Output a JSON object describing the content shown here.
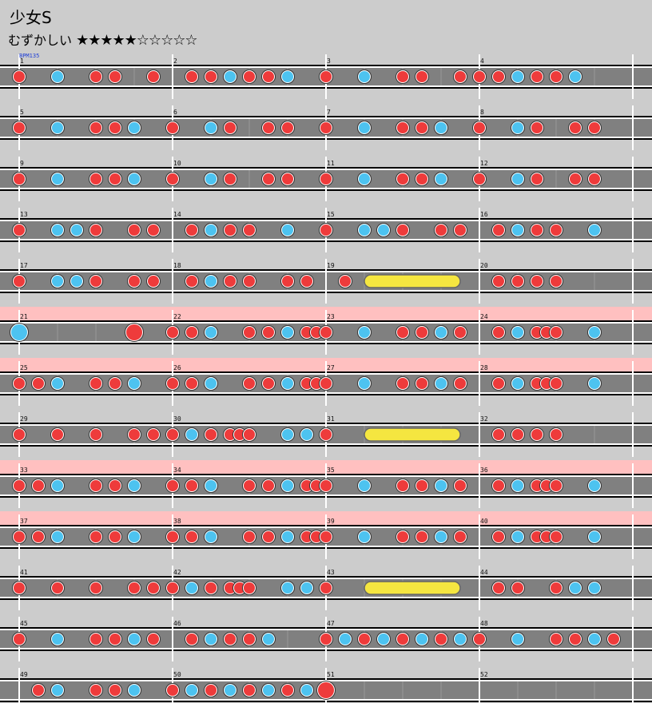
{
  "song": {
    "title": "少女S",
    "difficulty_label": "むずかしい",
    "stars_filled": "★★★★★",
    "stars_empty": "☆☆☆☆☆",
    "star_rating": 5,
    "star_max": 10
  },
  "bpm_label": "BPM135",
  "colors": {
    "background": "#cccccc",
    "lane": "#808080",
    "gogo_band": "#ffc0c0",
    "don": "#ee3b3b",
    "ka": "#4dc3f0",
    "drumroll": "#f5e640"
  },
  "chart_data": {
    "type": "taiko-chart",
    "bpm": 135,
    "measures_per_row": 4,
    "subdivisions_per_measure": 16,
    "notes_legend": "d=don(red) k=ka(blue) D=big don K=big ka",
    "rows": [
      {
        "gogo": false,
        "measures": [
          1,
          2,
          3,
          4
        ],
        "notes": [
          [
            "d",
            0
          ],
          [
            "k",
            4
          ],
          [
            "d",
            8
          ],
          [
            "d",
            10
          ],
          [
            "d",
            14
          ],
          [
            "d",
            18
          ],
          [
            "d",
            20
          ],
          [
            "k",
            22
          ],
          [
            "d",
            24
          ],
          [
            "d",
            26
          ],
          [
            "k",
            28
          ],
          [
            "d",
            32
          ],
          [
            "k",
            36
          ],
          [
            "d",
            40
          ],
          [
            "d",
            42
          ],
          [
            "d",
            46
          ],
          [
            "d",
            48
          ],
          [
            "d",
            50
          ],
          [
            "k",
            52
          ],
          [
            "d",
            54
          ],
          [
            "d",
            56
          ],
          [
            "k",
            58
          ]
        ],
        "rolls": []
      },
      {
        "gogo": false,
        "measures": [
          5,
          6,
          7,
          8
        ],
        "notes": [
          [
            "d",
            0
          ],
          [
            "k",
            4
          ],
          [
            "d",
            8
          ],
          [
            "d",
            10
          ],
          [
            "k",
            12
          ],
          [
            "d",
            16
          ],
          [
            "k",
            20
          ],
          [
            "d",
            22
          ],
          [
            "d",
            26
          ],
          [
            "d",
            28
          ],
          [
            "d",
            32
          ],
          [
            "k",
            36
          ],
          [
            "d",
            40
          ],
          [
            "d",
            42
          ],
          [
            "k",
            44
          ],
          [
            "d",
            48
          ],
          [
            "k",
            52
          ],
          [
            "d",
            54
          ],
          [
            "d",
            58
          ],
          [
            "d",
            60
          ]
        ],
        "rolls": []
      },
      {
        "gogo": false,
        "measures": [
          9,
          10,
          11,
          12
        ],
        "notes": [
          [
            "d",
            0
          ],
          [
            "k",
            4
          ],
          [
            "d",
            8
          ],
          [
            "d",
            10
          ],
          [
            "k",
            12
          ],
          [
            "d",
            16
          ],
          [
            "k",
            20
          ],
          [
            "d",
            22
          ],
          [
            "d",
            26
          ],
          [
            "d",
            28
          ],
          [
            "d",
            32
          ],
          [
            "k",
            36
          ],
          [
            "d",
            40
          ],
          [
            "d",
            42
          ],
          [
            "k",
            44
          ],
          [
            "d",
            48
          ],
          [
            "k",
            52
          ],
          [
            "d",
            54
          ],
          [
            "d",
            58
          ],
          [
            "d",
            60
          ]
        ],
        "rolls": []
      },
      {
        "gogo": false,
        "measures": [
          13,
          14,
          15,
          16
        ],
        "notes": [
          [
            "d",
            0
          ],
          [
            "k",
            4
          ],
          [
            "k",
            6
          ],
          [
            "d",
            8
          ],
          [
            "d",
            12
          ],
          [
            "d",
            14
          ],
          [
            "d",
            18
          ],
          [
            "k",
            20
          ],
          [
            "d",
            22
          ],
          [
            "d",
            24
          ],
          [
            "k",
            28
          ],
          [
            "d",
            32
          ],
          [
            "k",
            36
          ],
          [
            "k",
            38
          ],
          [
            "d",
            40
          ],
          [
            "d",
            44
          ],
          [
            "d",
            46
          ],
          [
            "d",
            50
          ],
          [
            "k",
            52
          ],
          [
            "d",
            54
          ],
          [
            "d",
            56
          ],
          [
            "k",
            60
          ]
        ],
        "rolls": []
      },
      {
        "gogo": false,
        "measures": [
          17,
          18,
          19,
          20
        ],
        "notes": [
          [
            "d",
            0
          ],
          [
            "k",
            4
          ],
          [
            "k",
            6
          ],
          [
            "d",
            8
          ],
          [
            "d",
            12
          ],
          [
            "d",
            14
          ],
          [
            "d",
            18
          ],
          [
            "k",
            20
          ],
          [
            "d",
            22
          ],
          [
            "d",
            24
          ],
          [
            "d",
            28
          ],
          [
            "d",
            30
          ],
          [
            "d",
            34
          ],
          [
            "d",
            50
          ],
          [
            "d",
            52
          ],
          [
            "d",
            54
          ],
          [
            "d",
            56
          ]
        ],
        "rolls": [
          [
            36,
            46
          ]
        ]
      },
      {
        "gogo": true,
        "measures": [
          21,
          22,
          23,
          24
        ],
        "notes": [
          [
            "K",
            0
          ],
          [
            "D",
            12
          ],
          [
            "d",
            16
          ],
          [
            "d",
            18
          ],
          [
            "k",
            20
          ],
          [
            "d",
            24
          ],
          [
            "d",
            26
          ],
          [
            "k",
            28
          ],
          [
            "d",
            30
          ],
          [
            "d",
            31
          ],
          [
            "d",
            32
          ],
          [
            "k",
            36
          ],
          [
            "d",
            40
          ],
          [
            "d",
            42
          ],
          [
            "k",
            44
          ],
          [
            "d",
            46
          ],
          [
            "d",
            50
          ],
          [
            "k",
            52
          ],
          [
            "d",
            54
          ],
          [
            "d",
            55
          ],
          [
            "d",
            56
          ],
          [
            "k",
            60
          ]
        ],
        "rolls": []
      },
      {
        "gogo": true,
        "measures": [
          25,
          26,
          27,
          28
        ],
        "notes": [
          [
            "d",
            0
          ],
          [
            "d",
            2
          ],
          [
            "k",
            4
          ],
          [
            "d",
            8
          ],
          [
            "d",
            10
          ],
          [
            "k",
            12
          ],
          [
            "d",
            16
          ],
          [
            "d",
            18
          ],
          [
            "k",
            20
          ],
          [
            "d",
            24
          ],
          [
            "d",
            26
          ],
          [
            "k",
            28
          ],
          [
            "d",
            30
          ],
          [
            "d",
            31
          ],
          [
            "d",
            32
          ],
          [
            "k",
            36
          ],
          [
            "d",
            40
          ],
          [
            "d",
            42
          ],
          [
            "k",
            44
          ],
          [
            "d",
            46
          ],
          [
            "d",
            50
          ],
          [
            "k",
            52
          ],
          [
            "d",
            54
          ],
          [
            "d",
            55
          ],
          [
            "d",
            56
          ],
          [
            "k",
            60
          ]
        ],
        "rolls": []
      },
      {
        "gogo": false,
        "measures": [
          29,
          30,
          31,
          32
        ],
        "notes": [
          [
            "d",
            0
          ],
          [
            "d",
            4
          ],
          [
            "d",
            8
          ],
          [
            "d",
            12
          ],
          [
            "d",
            14
          ],
          [
            "d",
            16
          ],
          [
            "k",
            18
          ],
          [
            "d",
            20
          ],
          [
            "d",
            22
          ],
          [
            "d",
            23
          ],
          [
            "d",
            24
          ],
          [
            "k",
            28
          ],
          [
            "k",
            30
          ],
          [
            "d",
            32
          ],
          [
            "d",
            50
          ],
          [
            "d",
            52
          ],
          [
            "d",
            54
          ],
          [
            "d",
            56
          ]
        ],
        "rolls": [
          [
            36,
            46
          ]
        ]
      },
      {
        "gogo": true,
        "measures": [
          33,
          34,
          35,
          36
        ],
        "notes": [
          [
            "d",
            0
          ],
          [
            "d",
            2
          ],
          [
            "k",
            4
          ],
          [
            "d",
            8
          ],
          [
            "d",
            10
          ],
          [
            "k",
            12
          ],
          [
            "d",
            16
          ],
          [
            "d",
            18
          ],
          [
            "k",
            20
          ],
          [
            "d",
            24
          ],
          [
            "d",
            26
          ],
          [
            "k",
            28
          ],
          [
            "d",
            30
          ],
          [
            "d",
            31
          ],
          [
            "d",
            32
          ],
          [
            "k",
            36
          ],
          [
            "d",
            40
          ],
          [
            "d",
            42
          ],
          [
            "k",
            44
          ],
          [
            "d",
            46
          ],
          [
            "d",
            50
          ],
          [
            "k",
            52
          ],
          [
            "d",
            54
          ],
          [
            "d",
            55
          ],
          [
            "d",
            56
          ],
          [
            "k",
            60
          ]
        ],
        "rolls": []
      },
      {
        "gogo": true,
        "measures": [
          37,
          38,
          39,
          40
        ],
        "notes": [
          [
            "d",
            0
          ],
          [
            "d",
            2
          ],
          [
            "k",
            4
          ],
          [
            "d",
            8
          ],
          [
            "d",
            10
          ],
          [
            "k",
            12
          ],
          [
            "d",
            16
          ],
          [
            "d",
            18
          ],
          [
            "k",
            20
          ],
          [
            "d",
            24
          ],
          [
            "d",
            26
          ],
          [
            "k",
            28
          ],
          [
            "d",
            30
          ],
          [
            "d",
            31
          ],
          [
            "d",
            32
          ],
          [
            "k",
            36
          ],
          [
            "d",
            40
          ],
          [
            "d",
            42
          ],
          [
            "k",
            44
          ],
          [
            "d",
            46
          ],
          [
            "d",
            50
          ],
          [
            "k",
            52
          ],
          [
            "d",
            54
          ],
          [
            "d",
            55
          ],
          [
            "d",
            56
          ],
          [
            "k",
            60
          ]
        ],
        "rolls": []
      },
      {
        "gogo": false,
        "measures": [
          41,
          42,
          43,
          44
        ],
        "notes": [
          [
            "d",
            0
          ],
          [
            "d",
            4
          ],
          [
            "d",
            8
          ],
          [
            "d",
            12
          ],
          [
            "d",
            14
          ],
          [
            "d",
            16
          ],
          [
            "k",
            18
          ],
          [
            "d",
            20
          ],
          [
            "d",
            22
          ],
          [
            "d",
            23
          ],
          [
            "d",
            24
          ],
          [
            "k",
            28
          ],
          [
            "k",
            30
          ],
          [
            "d",
            32
          ],
          [
            "d",
            50
          ],
          [
            "d",
            52
          ],
          [
            "d",
            56
          ],
          [
            "k",
            58
          ],
          [
            "k",
            60
          ]
        ],
        "rolls": [
          [
            36,
            46
          ]
        ]
      },
      {
        "gogo": false,
        "measures": [
          45,
          46,
          47,
          48
        ],
        "notes": [
          [
            "d",
            0
          ],
          [
            "k",
            4
          ],
          [
            "d",
            8
          ],
          [
            "d",
            10
          ],
          [
            "k",
            12
          ],
          [
            "d",
            14
          ],
          [
            "d",
            18
          ],
          [
            "k",
            20
          ],
          [
            "d",
            22
          ],
          [
            "d",
            24
          ],
          [
            "k",
            26
          ],
          [
            "d",
            32
          ],
          [
            "k",
            34
          ],
          [
            "d",
            36
          ],
          [
            "k",
            38
          ],
          [
            "d",
            40
          ],
          [
            "k",
            42
          ],
          [
            "d",
            44
          ],
          [
            "k",
            46
          ],
          [
            "d",
            48
          ],
          [
            "k",
            52
          ],
          [
            "d",
            56
          ],
          [
            "d",
            58
          ],
          [
            "k",
            60
          ],
          [
            "d",
            62
          ]
        ],
        "rolls": []
      },
      {
        "gogo": false,
        "measures": [
          49,
          50,
          51,
          52
        ],
        "notes": [
          [
            "d",
            2
          ],
          [
            "k",
            4
          ],
          [
            "d",
            8
          ],
          [
            "d",
            10
          ],
          [
            "k",
            12
          ],
          [
            "d",
            16
          ],
          [
            "k",
            18
          ],
          [
            "d",
            20
          ],
          [
            "k",
            22
          ],
          [
            "d",
            24
          ],
          [
            "k",
            26
          ],
          [
            "d",
            28
          ],
          [
            "k",
            30
          ],
          [
            "D",
            32
          ]
        ],
        "rolls": []
      }
    ]
  }
}
